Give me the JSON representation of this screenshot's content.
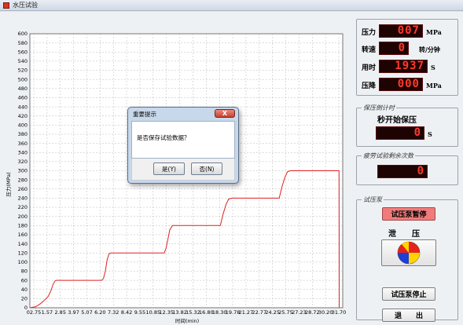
{
  "window": {
    "title": "水压试验"
  },
  "chart_data": {
    "type": "line",
    "ylabel": "压力(MPa)",
    "xlabel": "时间(min)",
    "ylim": [
      0,
      600
    ],
    "yticks": [
      0,
      20,
      40,
      60,
      80,
      100,
      120,
      140,
      160,
      180,
      200,
      220,
      240,
      260,
      280,
      300,
      320,
      340,
      360,
      380,
      400,
      420,
      440,
      460,
      480,
      500,
      520,
      540,
      560,
      580,
      600
    ],
    "xticks": [
      "02.75",
      "1.57",
      "2.85",
      "3.97",
      "5.07",
      "6.20",
      "7.32",
      "8.42",
      "9.55",
      "10.85",
      "12.35",
      "13.82",
      "15.32",
      "16.80",
      "18.30",
      "19.78",
      "21.27",
      "22.77",
      "24.25",
      "25.75",
      "27.23",
      "28.72",
      "30.20",
      "31.70"
    ],
    "series": [
      {
        "color": "#e02020",
        "points": [
          [
            0,
            0
          ],
          [
            0.6,
            2
          ],
          [
            1.1,
            8
          ],
          [
            1.5,
            15
          ],
          [
            2.0,
            25
          ],
          [
            2.3,
            38
          ],
          [
            2.5,
            50
          ],
          [
            2.7,
            58
          ],
          [
            2.85,
            60
          ],
          [
            3.2,
            60
          ],
          [
            7.8,
            60
          ],
          [
            8.0,
            64
          ],
          [
            8.2,
            80
          ],
          [
            8.4,
            105
          ],
          [
            8.6,
            118
          ],
          [
            8.8,
            120
          ],
          [
            9.2,
            120
          ],
          [
            14.6,
            120
          ],
          [
            14.8,
            130
          ],
          [
            15.0,
            150
          ],
          [
            15.2,
            170
          ],
          [
            15.5,
            180
          ],
          [
            20.7,
            180
          ],
          [
            21.0,
            205
          ],
          [
            21.3,
            225
          ],
          [
            21.6,
            238
          ],
          [
            22.0,
            240
          ],
          [
            27.1,
            240
          ],
          [
            27.4,
            265
          ],
          [
            27.7,
            285
          ],
          [
            28.0,
            298
          ],
          [
            28.3,
            300
          ],
          [
            33.6,
            300
          ],
          [
            33.62,
            0
          ]
        ]
      }
    ],
    "grid": true
  },
  "panel": {
    "pressure": {
      "label": "压力",
      "value": "007",
      "unit": "MPa"
    },
    "speed": {
      "label": "转速",
      "value": "0",
      "unit": "转/分钟"
    },
    "elapsed": {
      "label": "用时",
      "value": "1937",
      "unit": "S"
    },
    "drop": {
      "label": "压降",
      "value": "000",
      "unit": "MPa"
    },
    "hold": {
      "legend": "保压倒计时",
      "text": "秒开始保压",
      "value": "0",
      "unit": "S"
    },
    "fatigue": {
      "legend": "疲劳试验剩余次数",
      "value": "0"
    },
    "pump": {
      "legend": "试压泵",
      "pause_label": "试压泵暂停",
      "release_label": "泄　　压",
      "stop_label": "试压泵停止",
      "exit_label": "退　　出"
    }
  },
  "dialog": {
    "title": "重要提示",
    "message": "是否保存试验数据？",
    "yes_label": "是(Y)",
    "no_label": "否(N)",
    "close_label": "X"
  }
}
